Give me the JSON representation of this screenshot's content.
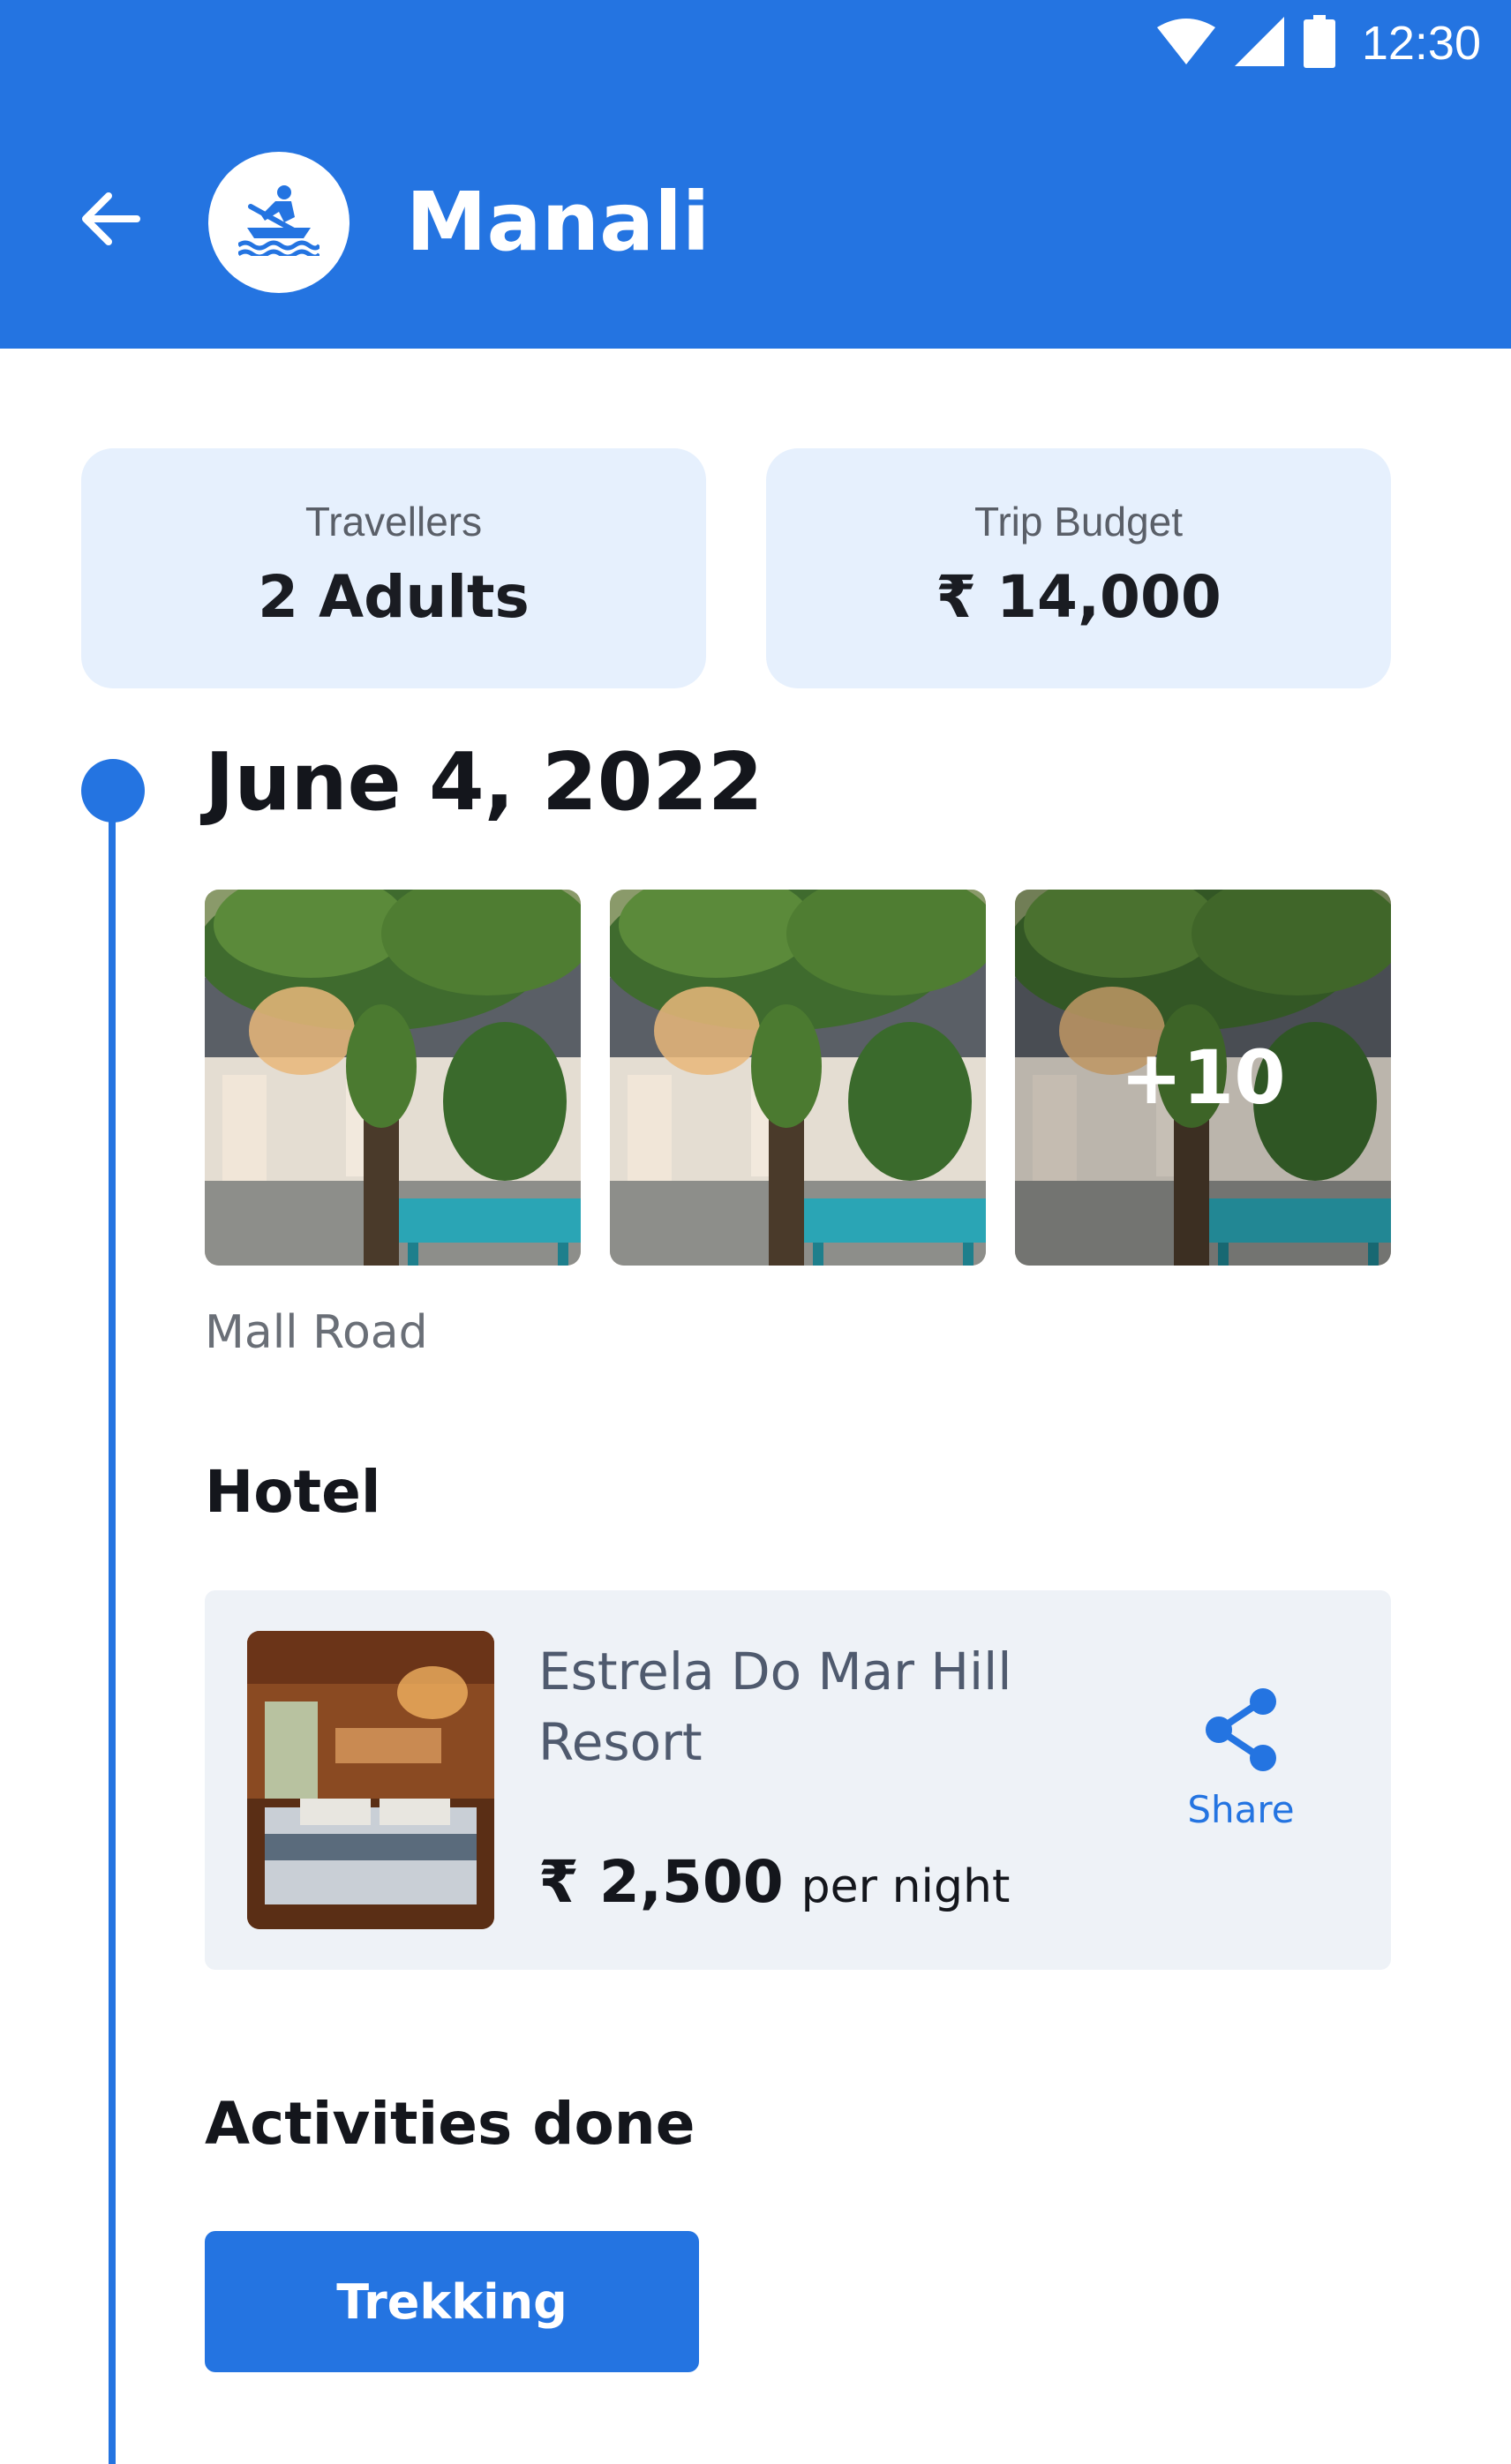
{
  "status_bar": {
    "time": "12:30",
    "icons": [
      "wifi-icon",
      "signal-icon",
      "battery-icon"
    ]
  },
  "header": {
    "title": "Manali",
    "back_icon": "arrow-back-icon",
    "logo_icon": "rowing-boat-icon"
  },
  "summary": {
    "travellers": {
      "label": "Travellers",
      "value": "2 Adults"
    },
    "budget": {
      "label": "Trip Budget",
      "value": "₹ 14,000"
    }
  },
  "day": {
    "date": "June 4, 2022",
    "photos_more": "+10",
    "place": "Mall Road"
  },
  "hotel": {
    "section_title": "Hotel",
    "name": "Estrela Do Mar Hill Resort",
    "price": "₹ 2,500",
    "price_unit": "per night",
    "share_label": "Share",
    "share_icon": "share-icon"
  },
  "activities": {
    "section_title": "Activities done",
    "items": [
      "Trekking"
    ]
  },
  "colors": {
    "primary": "#2474e1",
    "card_bg": "#e6f0fd",
    "hotel_bg": "#eef2f7"
  }
}
